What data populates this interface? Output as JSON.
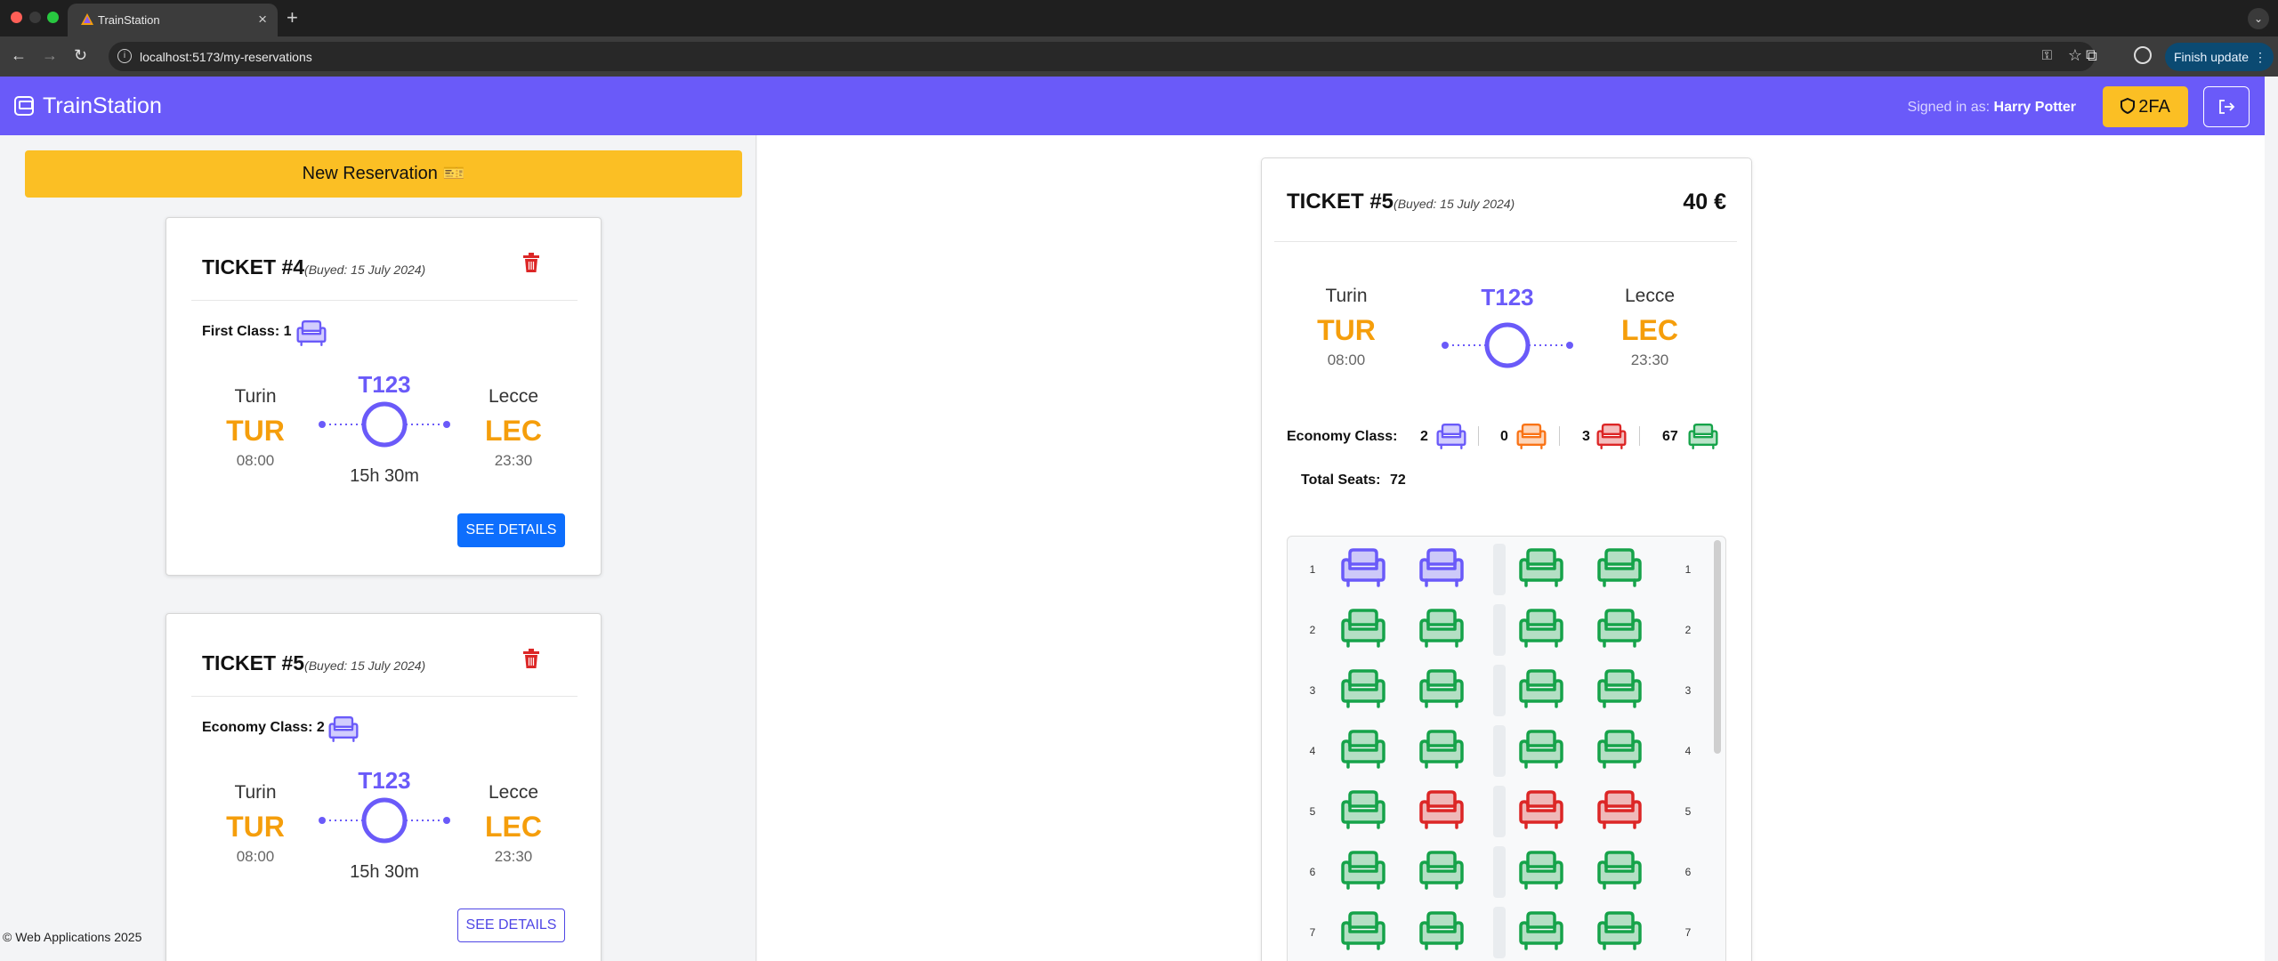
{
  "browser": {
    "tab_title": "TrainStation",
    "tab_close": "×",
    "new_tab": "+",
    "url": "localhost:5173/my-reservations",
    "finish_update": "Finish update",
    "tabs_menu": "⌄"
  },
  "navbar": {
    "brand": "TrainStation",
    "signed_prefix": "Signed in as:",
    "user": "Harry Potter",
    "twofa": "2FA",
    "colors": {
      "primary": "#6a5af9",
      "accent": "#fbbf24"
    }
  },
  "left": {
    "new_reservation": "New Reservation 🎫",
    "tickets": [
      {
        "title": "TICKET #4",
        "date": "(Buyed: 15 July 2024)",
        "class_label": "First Class: 1",
        "from_city": "Turin",
        "from_code": "TUR",
        "from_time": "08:00",
        "train": "T123",
        "duration": "15h 30m",
        "to_city": "Lecce",
        "to_code": "LEC",
        "to_time": "23:30",
        "button": "SEE DETAILS"
      },
      {
        "title": "TICKET #5",
        "date": "(Buyed: 15 July 2024)",
        "class_label": "Economy Class: 2",
        "from_city": "Turin",
        "from_code": "TUR",
        "from_time": "08:00",
        "train": "T123",
        "duration": "15h 30m",
        "to_city": "Lecce",
        "to_code": "LEC",
        "to_time": "23:30",
        "button": "SEE DETAILS"
      }
    ],
    "footer": "© Web Applications 2025"
  },
  "detail": {
    "title": "TICKET #5",
    "date": "(Buyed: 15 July 2024)",
    "price": "40 €",
    "from_city": "Turin",
    "from_code": "TUR",
    "from_time": "08:00",
    "train": "T123",
    "to_city": "Lecce",
    "to_code": "LEC",
    "to_time": "23:30",
    "class_label": "Economy Class:",
    "counts": {
      "selected": "2",
      "requested": "0",
      "occupied": "3",
      "available": "67"
    },
    "total_label": "Total Seats:",
    "total_value": "72",
    "seat_colors": {
      "selected": "#6a5af9",
      "requested": "#f97316",
      "occupied": "#dc2626",
      "available": "#16a34a"
    },
    "rows": [
      {
        "num": "1",
        "seats": [
          "selected",
          "selected",
          "available",
          "available"
        ]
      },
      {
        "num": "2",
        "seats": [
          "available",
          "available",
          "available",
          "available"
        ]
      },
      {
        "num": "3",
        "seats": [
          "available",
          "available",
          "available",
          "available"
        ]
      },
      {
        "num": "4",
        "seats": [
          "available",
          "available",
          "available",
          "available"
        ]
      },
      {
        "num": "5",
        "seats": [
          "available",
          "occupied",
          "occupied",
          "occupied"
        ]
      },
      {
        "num": "6",
        "seats": [
          "available",
          "available",
          "available",
          "available"
        ]
      },
      {
        "num": "7",
        "seats": [
          "available",
          "available",
          "available",
          "available"
        ]
      }
    ]
  }
}
